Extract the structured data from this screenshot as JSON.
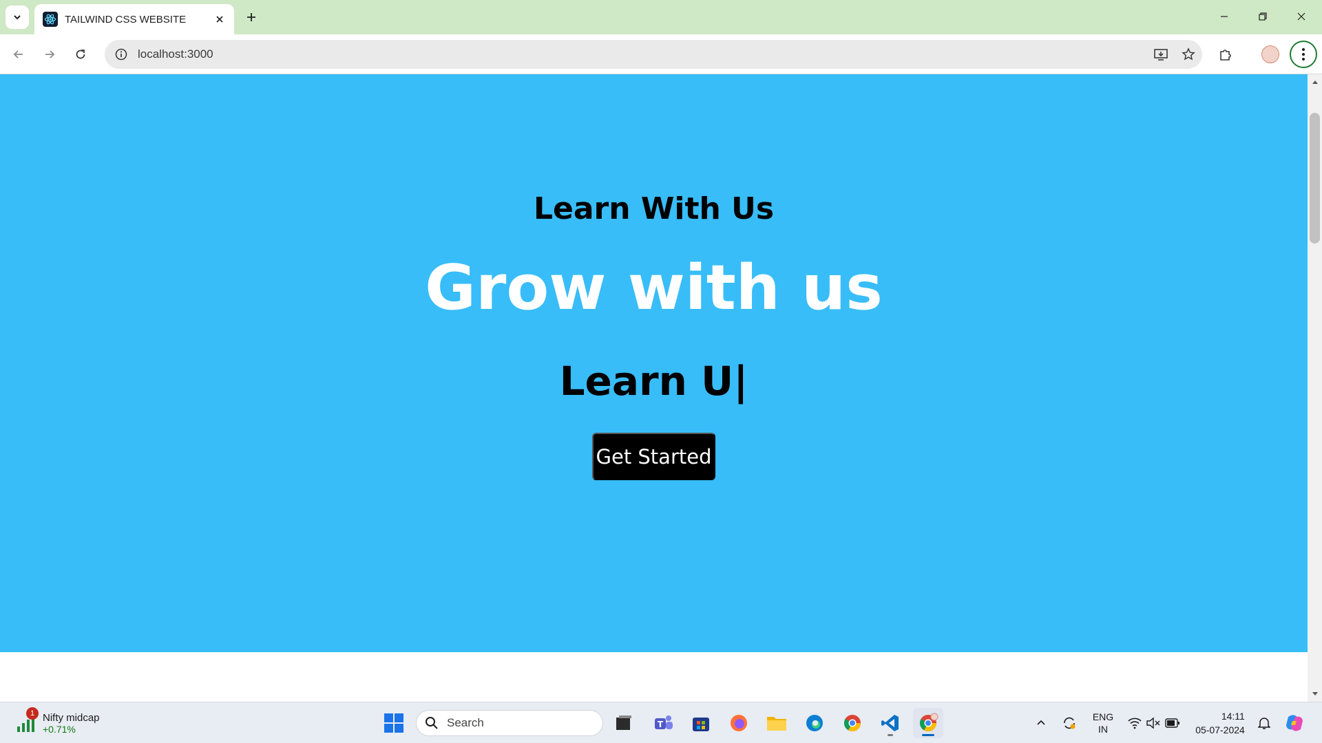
{
  "browser": {
    "tab": {
      "title": "TAILWIND CSS WEBSITE"
    },
    "url": "localhost:3000"
  },
  "page": {
    "kicker": "Learn With Us",
    "headline": "Grow with us",
    "typed_text": "Learn U",
    "typed_cursor": "|",
    "cta_label": "Get Started",
    "colors": {
      "hero_bg": "#38bdf8",
      "headline": "#ffffff",
      "cta_bg": "#000000"
    }
  },
  "taskbar": {
    "widget": {
      "title": "Nifty midcap",
      "value": "+0.71%",
      "badge": "1"
    },
    "search_placeholder": "Search",
    "language": {
      "line1": "ENG",
      "line2": "IN"
    },
    "clock": {
      "time": "14:11",
      "date": "05-07-2024"
    }
  }
}
